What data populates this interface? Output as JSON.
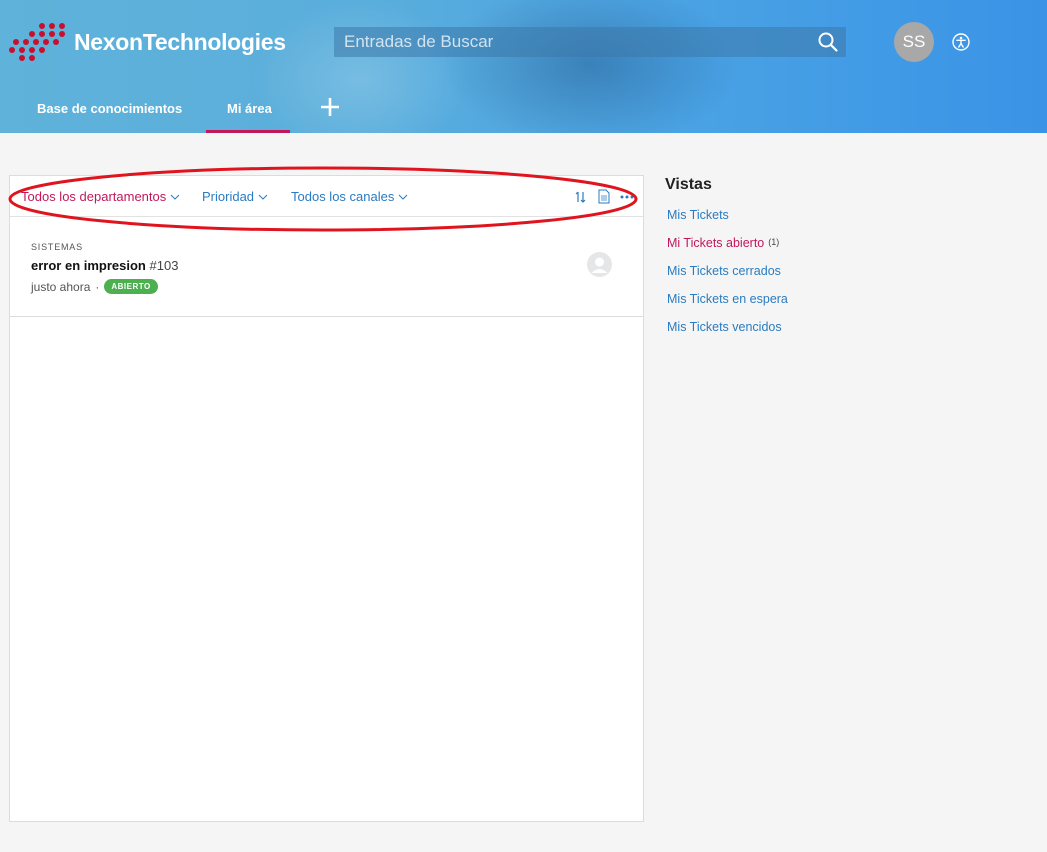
{
  "header": {
    "brand": "NexonTechnologies",
    "search_placeholder": "Entradas de Buscar",
    "avatar_initials": "SS",
    "tabs": [
      {
        "label": "Base de conocimientos"
      },
      {
        "label": "Mi área",
        "active": true
      }
    ]
  },
  "filters": {
    "department": "Todos los departamentos",
    "priority": "Prioridad",
    "channel": "Todos los canales"
  },
  "tickets": [
    {
      "department": "SISTEMAS",
      "title": "error en impresion",
      "number": "#103",
      "time": "justo ahora",
      "separator": "·",
      "status": "ABIERTO"
    }
  ],
  "sidebar": {
    "title": "Vistas",
    "views": [
      {
        "label": "Mis Tickets"
      },
      {
        "label": "Mi Tickets abierto",
        "count": "(1)",
        "active": true
      },
      {
        "label": "Mis Tickets cerrados"
      },
      {
        "label": "Mis Tickets en espera"
      },
      {
        "label": "Mis Tickets vencidos"
      }
    ]
  },
  "colors": {
    "accent": "#c2185b",
    "link": "#2b7bc0",
    "status_open": "#4caf50",
    "annotation": "#e0141e"
  }
}
